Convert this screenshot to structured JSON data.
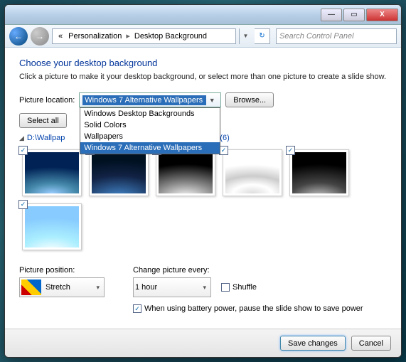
{
  "titlebar": {
    "min": "—",
    "max": "▭",
    "close": "X"
  },
  "nav": {
    "back": "←",
    "fwd": "→",
    "crumb_prefix": "«",
    "crumb1": "Personalization",
    "crumb2": "Desktop Background",
    "search_placeholder": "Search Control Panel"
  },
  "heading": "Choose your desktop background",
  "subtext": "Click a picture to make it your desktop background, or select more than one picture to create a slide show.",
  "loc_label": "Picture location:",
  "combo_selected": "Windows 7 Alternative Wallpapers",
  "dropdown_options": {
    "o1": "Windows Desktop Backgrounds",
    "o2": "Solid Colors",
    "o3": "Wallpapers",
    "o4": "Windows 7 Alternative Wallpapers"
  },
  "browse": "Browse...",
  "select_all": "Select all",
  "group_path": "D:\\Wallpap",
  "group_count": "(6)",
  "check": "✓",
  "pos_label": "Picture position:",
  "pos_value": "Stretch",
  "change_label": "Change picture every:",
  "change_value": "1 hour",
  "shuffle": "Shuffle",
  "battery": "When using battery power, pause the slide show to save power",
  "save": "Save changes",
  "cancel": "Cancel"
}
